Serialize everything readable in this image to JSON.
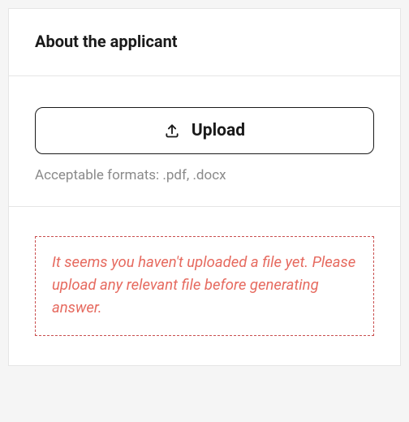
{
  "header": {
    "title": "About the applicant"
  },
  "upload": {
    "button_label": "Upload",
    "format_hint": "Acceptable formats: .pdf, .docx"
  },
  "warning": {
    "message": "It seems you haven't uploaded a file yet. Please upload any relevant file before generating answer."
  }
}
